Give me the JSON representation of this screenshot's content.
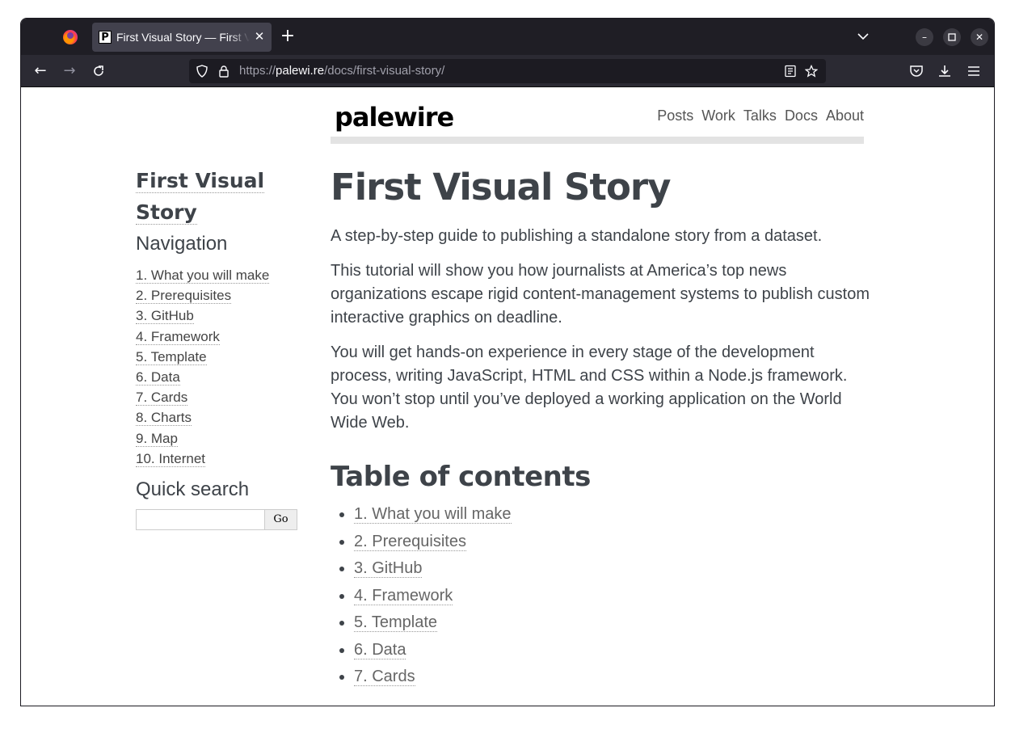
{
  "browser": {
    "tab_title": "First Visual Story — First Visual Story",
    "tab_favicon": "P",
    "url_prefix": "https://",
    "url_host": "palewi.re",
    "url_path": "/docs/first-visual-story/"
  },
  "site": {
    "logo": "palewire",
    "nav": [
      "Posts",
      "Work",
      "Talks",
      "Docs",
      "About"
    ]
  },
  "sidebar": {
    "title_line1": "First Visual",
    "title_line2": "Story",
    "nav_heading": "Navigation",
    "items": [
      "1. What you will make",
      "2. Prerequisites",
      "3. GitHub",
      "4. Framework",
      "5. Template",
      "6. Data",
      "7. Cards",
      "8. Charts",
      "9. Map",
      "10. Internet"
    ],
    "search_heading": "Quick search",
    "search_button": "Go"
  },
  "main": {
    "title": "First Visual Story",
    "intro": "A step-by-step guide to publishing a standalone story from a dataset.",
    "para1": "This tutorial will show you how journalists at America’s top news organizations escape rigid content-management systems to publish custom interactive graphics on deadline.",
    "para2": "You will get hands-on experience in every stage of the development process, writing JavaScript, HTML and CSS within a Node.js framework. You won’t stop until you’ve deployed a working application on the World Wide Web.",
    "toc_heading": "Table of contents",
    "toc": [
      "1. What you will make",
      "2. Prerequisites",
      "3. GitHub",
      "4. Framework",
      "5. Template",
      "6. Data",
      "7. Cards"
    ]
  }
}
